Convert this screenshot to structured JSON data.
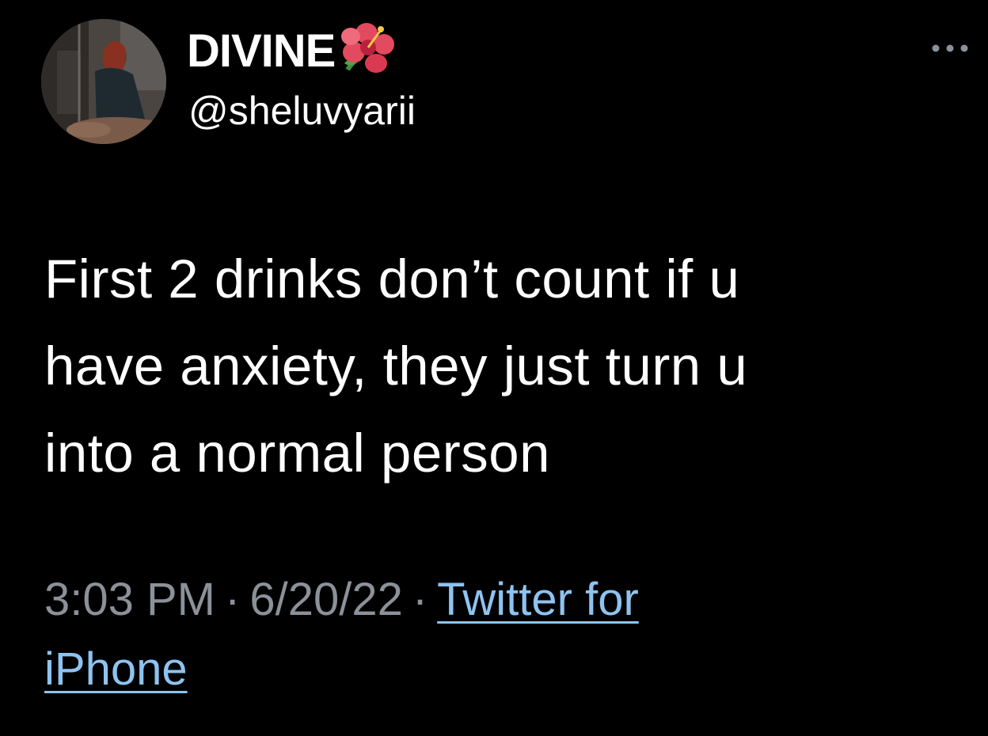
{
  "colors": {
    "background": "#000000",
    "text": "#ffffff",
    "muted": "#8b9199",
    "link": "#8ec3f0"
  },
  "author": {
    "display_name": "DIVINE",
    "name_emoji": "hibiscus-emoji",
    "handle": "@sheluvyarii",
    "avatar_icon": "profile-photo"
  },
  "menu": {
    "icon": "more-options-icon"
  },
  "tweet": {
    "lines": [
      "First 2 drinks don’t count if u",
      "have anxiety, they just turn u",
      "into a normal person"
    ]
  },
  "meta": {
    "time": "3:03 PM",
    "separator": "·",
    "date": "6/20/22",
    "source_part1": "Twitter for",
    "source_part2": "iPhone"
  }
}
